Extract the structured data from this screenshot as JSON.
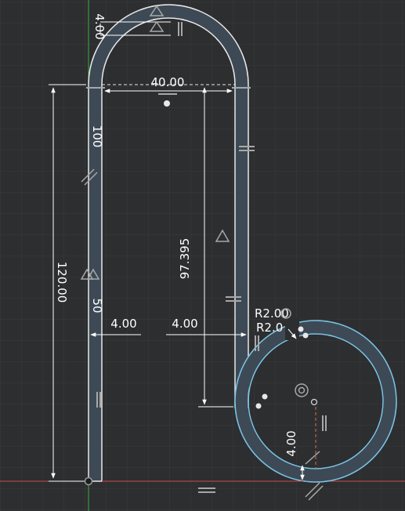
{
  "sketch": {
    "grid_color": "#3a3b3d",
    "background": "#2d2e30",
    "profile_fill": "#3d4a55",
    "profile_edge": "#e8e8e8",
    "selected_edge": "#7cc4e8",
    "x_axis_color": "#c94a4a",
    "y_axis_color": "#3fae3f",
    "dimension_color": "#ffffff",
    "constraint_color": "#a8a8a8"
  },
  "dimensions": {
    "top_thickness": "4.00",
    "arch_width": "40.00",
    "left_height": "100",
    "overall_height": "120.00",
    "left_mid": "50",
    "right_height": "97.395",
    "left_wall": "4.00",
    "right_wall": "4.00",
    "radius_outer": "R2.00",
    "radius_inner": "R2.0",
    "ring_thickness": "4.00"
  },
  "constraint_icons": [
    "fix-triangle-icon",
    "horizontal-icon",
    "vertical-icon",
    "parallel-icon",
    "concentric-icon",
    "coincident-icon"
  ]
}
